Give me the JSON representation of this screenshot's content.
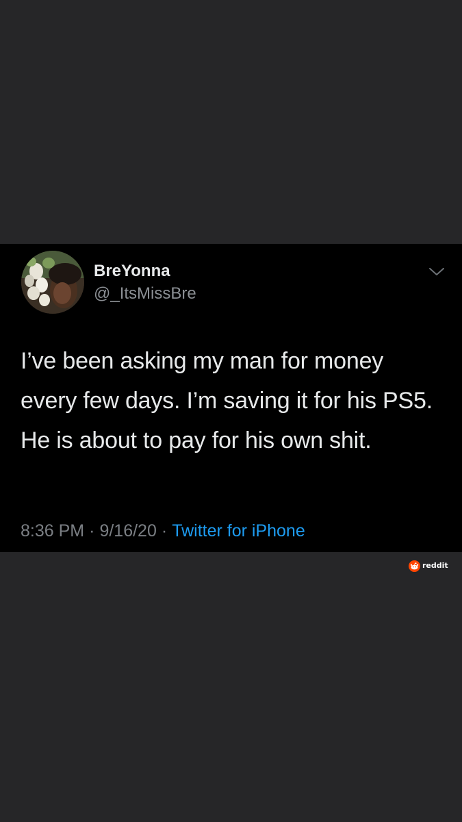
{
  "tweet": {
    "display_name": "BreYonna",
    "handle": "@_ItsMissBre",
    "text": "I’ve been asking my man for money every few days. I’m saving it for his PS5. He is about to pay for his own shit.",
    "time": "8:36 PM",
    "date": "9/16/20",
    "separator": "·",
    "source": "Twitter for iPhone",
    "menu_icon": "chevron-down-icon",
    "avatar_icon": "avatar"
  },
  "watermark": {
    "label": "reddit",
    "icon": "reddit-icon"
  },
  "colors": {
    "page_background": "#262628",
    "card_background": "#000000",
    "primary_text": "#e7e9ea",
    "secondary_text": "#8b8f94",
    "link": "#1d9bf0",
    "reddit_orange": "#ff4500"
  }
}
